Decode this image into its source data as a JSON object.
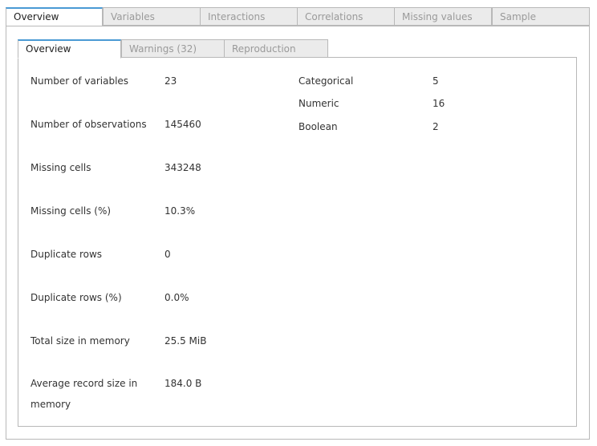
{
  "outer_tabs": [
    {
      "label": "Overview"
    },
    {
      "label": "Variables"
    },
    {
      "label": "Interactions"
    },
    {
      "label": "Correlations"
    },
    {
      "label": "Missing values"
    },
    {
      "label": "Sample"
    }
  ],
  "inner_tabs": [
    {
      "label": "Overview"
    },
    {
      "label": "Warnings (32)"
    },
    {
      "label": "Reproduction"
    }
  ],
  "dataset_stats": [
    {
      "label": "Number of variables",
      "value": "23"
    },
    {
      "label": "Number of observations",
      "value": "145460"
    },
    {
      "label": "Missing cells",
      "value": "343248"
    },
    {
      "label": "Missing cells (%)",
      "value": "10.3%"
    },
    {
      "label": "Duplicate rows",
      "value": "0"
    },
    {
      "label": "Duplicate rows (%)",
      "value": "0.0%"
    },
    {
      "label": "Total size in memory",
      "value": "25.5 MiB"
    },
    {
      "label": "Average record size in memory",
      "value": "184.0 B"
    }
  ],
  "variable_types": [
    {
      "label": "Categorical",
      "value": "5"
    },
    {
      "label": "Numeric",
      "value": "16"
    },
    {
      "label": "Boolean",
      "value": "2"
    }
  ],
  "colors": {
    "active_tab_accent": "#4a9ad4",
    "inactive_tab_bg": "#ebebeb",
    "border": "#b8b8b8"
  }
}
